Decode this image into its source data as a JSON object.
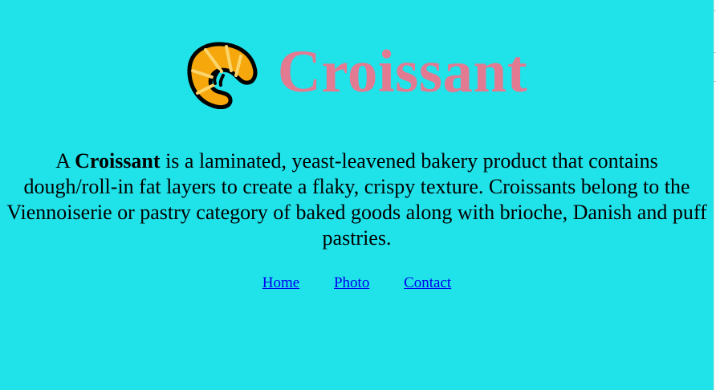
{
  "colors": {
    "background": "#20e3ea",
    "title": "#e27a92",
    "link": "#0000ee",
    "text": "#000000",
    "croissant_body": "#f5a70b",
    "croissant_outline": "#000000"
  },
  "header": {
    "logo_icon": "croissant-icon",
    "title": "Croissant"
  },
  "description": {
    "lead": "A ",
    "highlight": "Croissant",
    "body": " is a laminated, yeast-leavened bakery product that contains dough/roll-in fat layers to create a flaky, crispy texture. Croissants belong to the Viennoiserie or pastry category of baked goods along with brioche, Danish and puff pastries."
  },
  "nav": {
    "links": [
      {
        "label": "Home"
      },
      {
        "label": "Photo"
      },
      {
        "label": "Contact"
      }
    ]
  }
}
